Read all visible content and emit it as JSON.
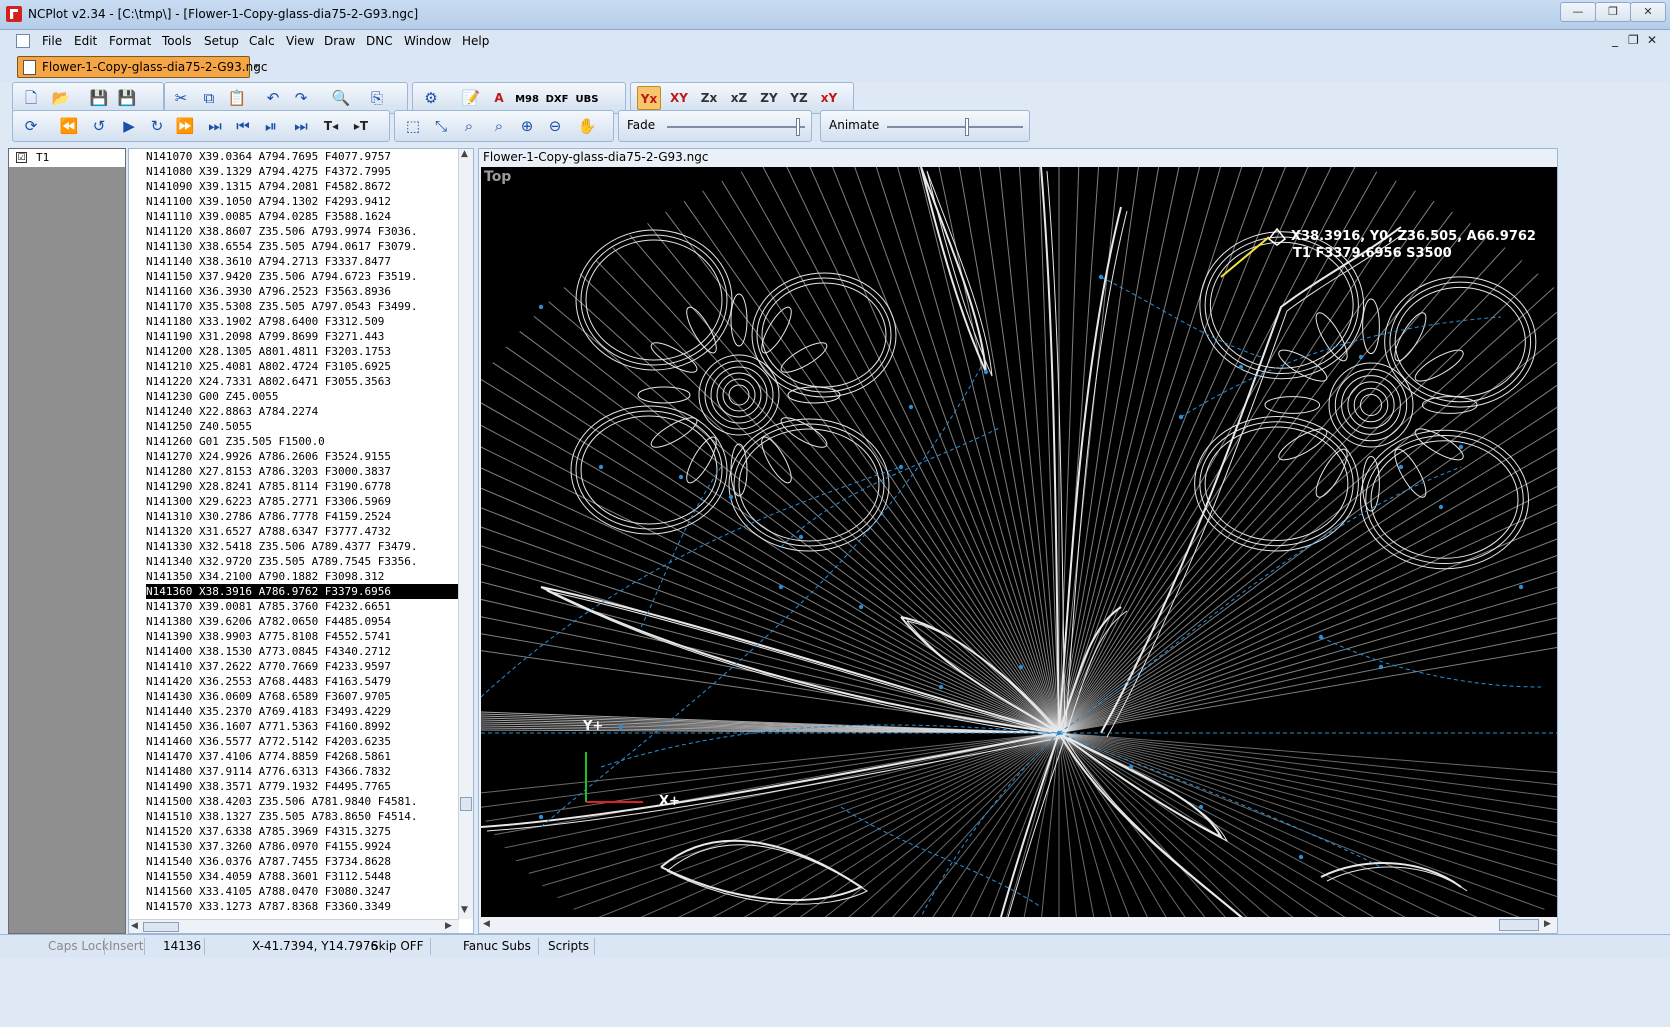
{
  "window": {
    "title": "NCPlot v2.34 - [C:\\tmp\\] - [Flower-1-Copy-glass-dia75-2-G93.ngc]",
    "controls": [
      "—",
      "❐",
      "✕"
    ]
  },
  "menu": {
    "items": [
      "File",
      "Edit",
      "Format",
      "Tools",
      "Setup",
      "Calc",
      "View",
      "Draw",
      "DNC",
      "Window",
      "Help"
    ],
    "mdi_controls": [
      "_",
      "❐",
      "✕"
    ]
  },
  "document_tab": {
    "label": "Flower-1-Copy-glass-dia75-2-G93.ngc"
  },
  "toolbar": {
    "m98_label": "M98",
    "dxf_label": "DXF",
    "ubs_label": "UBS",
    "fade_label": "Fade",
    "animate_label": "Animate",
    "fade_level": 0.98,
    "animate_level": 0.6
  },
  "tool_list": {
    "items": [
      {
        "checked": "☑",
        "name": "T1"
      }
    ]
  },
  "code": {
    "lines": [
      "N141070 X39.0364 A794.7695 F4077.9757",
      "N141080 X39.1329 A794.4275 F4372.7995",
      "N141090 X39.1315 A794.2081 F4582.8672",
      "N141100 X39.1050 A794.1302 F4293.9412",
      "N141110 X39.0085 A794.0285 F3588.1624",
      "N141120 X38.8607 Z35.506 A793.9974 F3036.",
      "N141130 X38.6554 Z35.505 A794.0617 F3079.",
      "N141140 X38.3610 A794.2713 F3337.8477",
      "N141150 X37.9420 Z35.506 A794.6723 F3519.",
      "N141160 X36.3930 A796.2523 F3563.8936",
      "N141170 X35.5308 Z35.505 A797.0543 F3499.",
      "N141180 X33.1902 A798.6400 F3312.509",
      "N141190 X31.2098 A799.8699 F3271.443",
      "N141200 X28.1305 A801.4811 F3203.1753",
      "N141210 X25.4081 A802.4724 F3105.6925",
      "N141220 X24.7331 A802.6471 F3055.3563",
      "N141230 G00 Z45.0055",
      "N141240 X22.8863 A784.2274",
      "N141250 Z40.5055",
      "N141260 G01 Z35.505 F1500.0",
      "N141270 X24.9926 A786.2606 F3524.9155",
      "N141280 X27.8153 A786.3203 F3000.3837",
      "N141290 X28.8241 A785.8114 F3190.6778",
      "N141300 X29.6223 A785.2771 F3306.5969",
      "N141310 X30.2786 A786.7778 F4159.2524",
      "N141320 X31.6527 A788.6347 F3777.4732",
      "N141330 X32.5418 Z35.506 A789.4377 F3479.",
      "N141340 X32.9720 Z35.505 A789.7545 F3356.",
      "N141350 X34.2100 A790.1882 F3098.312",
      "N141360 X38.3916 A786.9762 F3379.6956",
      "N141370 X39.0081 A785.3760 F4232.6651",
      "N141380 X39.6206 A782.0650 F4485.0954",
      "N141390 X38.9903 A775.8108 F4552.5741",
      "N141400 X38.1530 A773.0845 F4340.2712",
      "N141410 X37.2622 A770.7669 F4233.9597",
      "N141420 X36.2553 A768.4483 F4163.5479",
      "N141430 X36.0609 A768.6589 F3607.9705",
      "N141440 X35.2370 A769.4183 F3493.4229",
      "N141450 X36.1607 A771.5363 F4160.8992",
      "N141460 X36.5577 A772.5142 F4203.6235",
      "N141470 X37.4106 A774.8859 F4268.5861",
      "N141480 X37.9114 A776.6313 F4366.7832",
      "N141490 X38.3571 A779.1932 F4495.7765",
      "N141500 X38.4203 Z35.506 A781.9840 F4581.",
      "N141510 X38.1327 Z35.505 A783.8650 F4514.",
      "N141520 X37.6338 A785.3969 F4315.3275",
      "N141530 X37.3260 A786.0970 F4155.9924",
      "N141540 X36.0376 A787.7455 F3734.8628",
      "N141550 X34.4059 A788.3601 F3112.5448",
      "N141560 X33.4105 A788.0470 F3080.3247",
      "N141570 X33.1273 A787.8368 F3360.3349"
    ],
    "selected_index": 29
  },
  "graphics": {
    "window_title": "Flower-1-Copy-glass-dia75-2-G93.ngc",
    "view_label": "Top",
    "cursor_readout_line1": "X38.3916, Y0, Z36.505, A66.9762",
    "cursor_readout_line2": "T1 F3379.6956 S3500",
    "axis_y_label": "Y+",
    "axis_x_label": "X+"
  },
  "status": {
    "caps_lock": "Caps Lock",
    "insert": "Insert",
    "line_number": "14136",
    "coords": "X-41.7394, Y14.7976",
    "skip": "Skip OFF",
    "fanuc_subs": "Fanuc Subs",
    "scripts": "Scripts"
  },
  "colors": {
    "toolpath_cut": "#e8e8e8",
    "toolpath_rapid": "#2a8fd6",
    "current_move": "#f2e33a",
    "axis_x": "#e02020",
    "axis_y": "#20c020",
    "viewport_bg": "#000000",
    "tab_active": "#f6a544",
    "selection_bg": "#000000"
  }
}
